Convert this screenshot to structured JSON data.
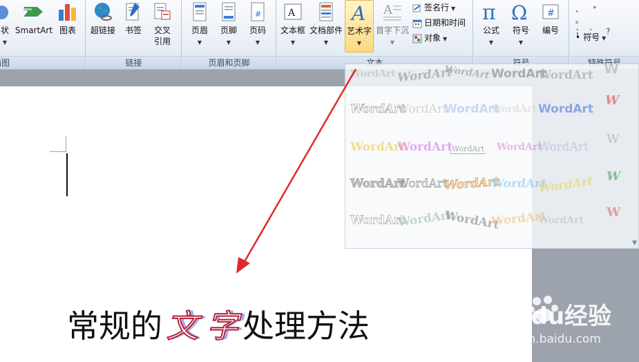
{
  "ribbon": {
    "groups": {
      "illustrations": {
        "label": "插图",
        "shape_label": "状",
        "smartart_label": "SmartArt",
        "chart_label": "图表"
      },
      "links": {
        "label": "链接",
        "hyperlink_label": "超链接",
        "bookmark_label": "书签",
        "crossref_label_1": "交叉",
        "crossref_label_2": "引用"
      },
      "headerfooter": {
        "label": "页眉和页脚",
        "header_label": "页眉",
        "footer_label": "页脚",
        "pagenum_label": "页码"
      },
      "text": {
        "label": "文本",
        "textbox_label": "文本框",
        "quickparts_label": "文档部件",
        "wordart_label": "艺术字",
        "dropcap_label": "首字下沉",
        "signature_label": "签名行",
        "datetime_label": "日期和时间",
        "object_label": "对象"
      },
      "symbols": {
        "label": "符号",
        "equation_label": "公式",
        "symbol_label": "符号",
        "number_label": "编号"
      },
      "special": {
        "label": "特殊符号",
        "symbol_menu_label": "符号"
      }
    }
  },
  "gallery": {
    "sample_text": "WordArt"
  },
  "document": {
    "caption_left": "常规的",
    "caption_fancy_1": "文",
    "caption_fancy_2": "字",
    "caption_right": "处理方法"
  },
  "watermark": {
    "brand": "Baidu经验",
    "url": "jingyan.baidu.com"
  },
  "colors": {
    "accent_arrow": "#e02a2a",
    "ribbon_bg": "#dfe7f2",
    "page_bg": "#ffffff",
    "workspace_bg": "#9da3ad"
  }
}
